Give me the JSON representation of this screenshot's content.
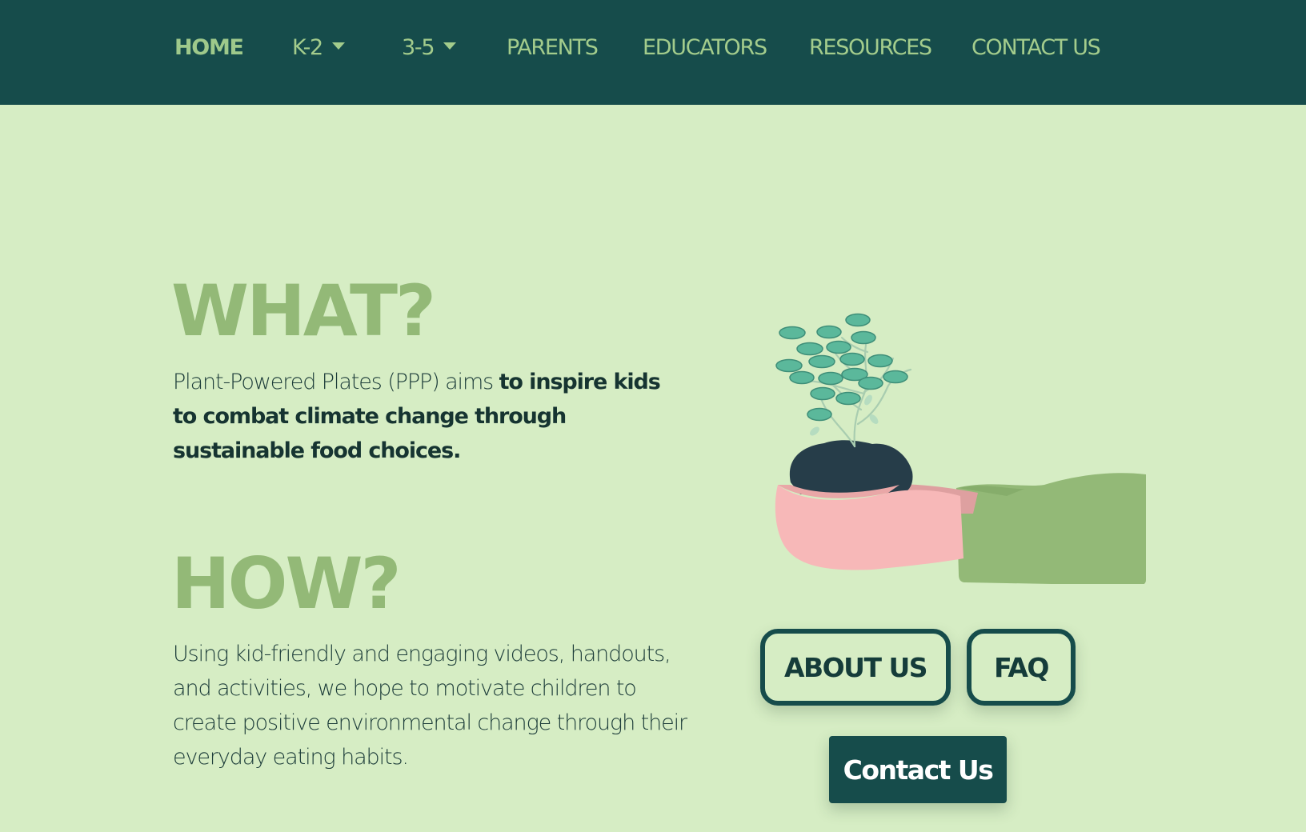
{
  "nav": {
    "home": "HOME",
    "k2": "K-2",
    "g35": "3-5",
    "parents": "PARENTS",
    "educators": "EDUCATORS",
    "resources": "RESOURCES",
    "contact": "CONTACT US"
  },
  "what": {
    "heading": "WHAT?",
    "text_plain": "Plant-Powered Plates (PPP) aims ",
    "text_bold": "to inspire kids to combat climate change through sustainable food choices."
  },
  "how": {
    "heading": "HOW?",
    "text": "Using kid-friendly and engaging videos, handouts, and activities, we hope to motivate children to create positive environmental change through their everyday eating habits."
  },
  "buttons": {
    "about": "ABOUT US",
    "faq": "FAQ",
    "contact": "Contact Us"
  },
  "colors": {
    "nav_bg": "#164c4b",
    "page_bg": "#d6edc4",
    "accent_green": "#93b977",
    "dark_text": "#163431"
  },
  "icons": {
    "illustration": "hand-holding-plant-seedling"
  }
}
